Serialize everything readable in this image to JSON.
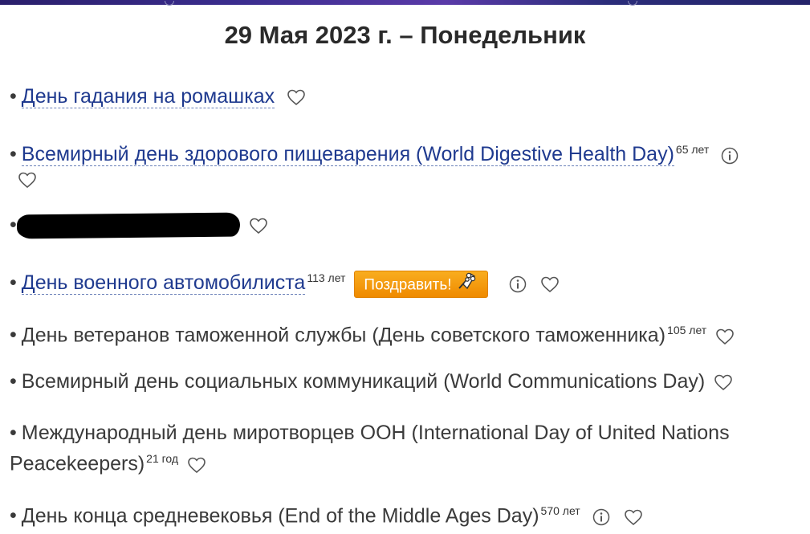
{
  "header": {
    "title": "29 Мая 2023 г. – Понедельник"
  },
  "colors": {
    "link": "#1f3a8f",
    "congrats_button": "#f39a0e",
    "text": "#3a3a3a"
  },
  "items": [
    {
      "bullet": "•",
      "label": "День гадания на ромашках",
      "is_link": true,
      "years": ""
    },
    {
      "bullet": "•",
      "label": "Всемирный день здорового пищеварения (World Digestive Health Day)",
      "is_link": true,
      "years": "65 лет"
    },
    {
      "bullet": "•",
      "label": "",
      "redacted": true,
      "years": ""
    },
    {
      "bullet": "•",
      "label": "День военного автомобилиста",
      "is_link": true,
      "years": "113 лет",
      "congrats_label": "Поздравить!"
    },
    {
      "bullet": "•",
      "label": "День ветеранов таможенной службы (День советского таможенника)",
      "is_link": false,
      "years": "105 лет"
    },
    {
      "bullet": "•",
      "label": "Всемирный день социальных коммуникаций (World Communications Day)",
      "is_link": false,
      "years": ""
    },
    {
      "bullet": "•",
      "label": "Международный день миротворцев ООН (International Day of United Nations Peacekeepers)",
      "is_link": false,
      "years": "21 год"
    },
    {
      "bullet": "•",
      "label": "День конца средневековья (End of the Middle Ages Day)",
      "is_link": false,
      "years": "570 лет"
    }
  ],
  "icons": {
    "heart": "heart-outline-icon",
    "info": "info-circle-icon",
    "flower": "bouquet-icon"
  }
}
